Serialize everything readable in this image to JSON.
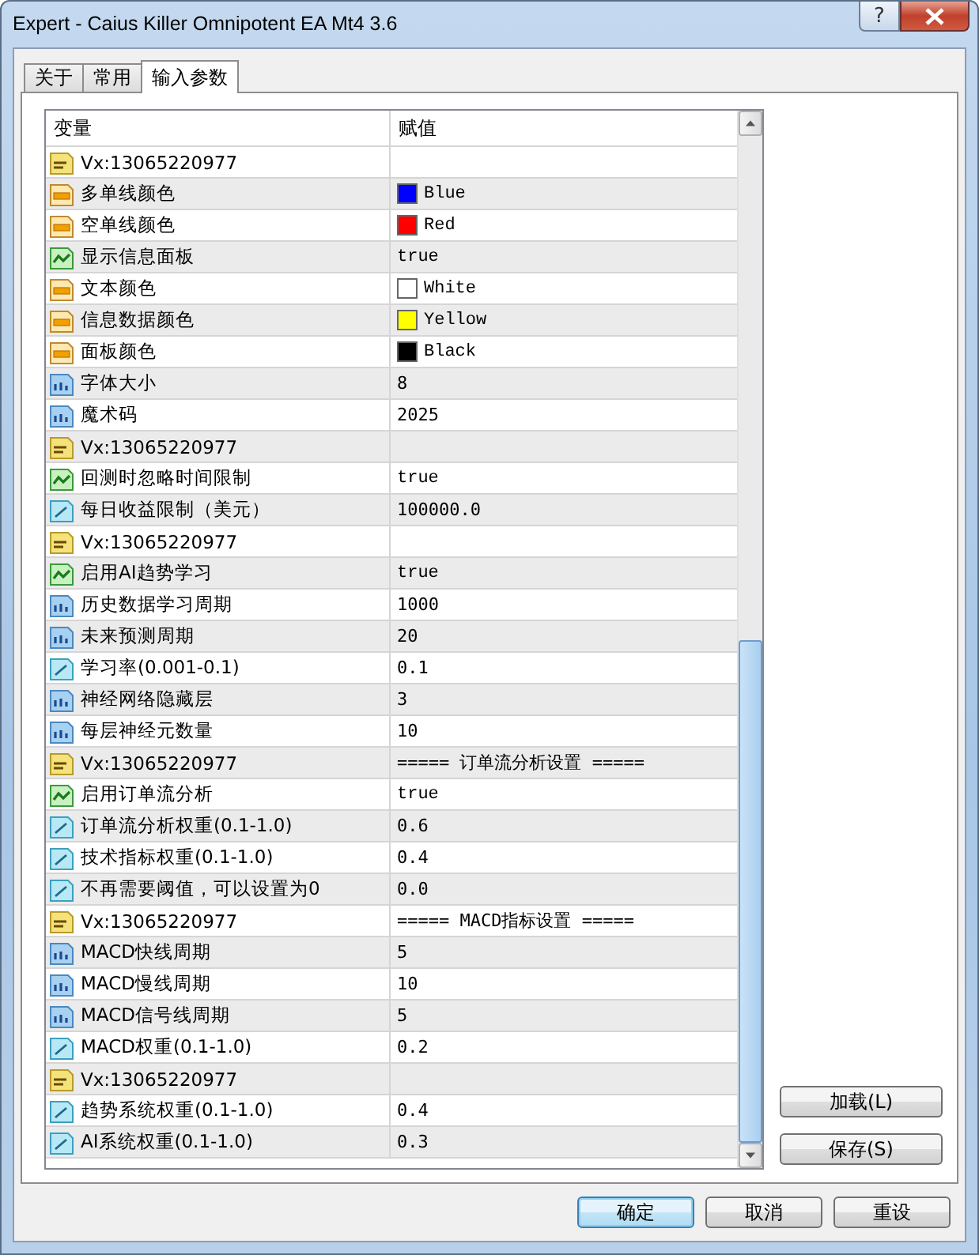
{
  "window": {
    "title": "Expert - Caius Killer Omnipotent EA Mt4 3.6",
    "help": "?"
  },
  "tabs": [
    {
      "label": "关于",
      "selected": false
    },
    {
      "label": "常用",
      "selected": false
    },
    {
      "label": "输入参数",
      "selected": true
    }
  ],
  "table": {
    "columns": [
      "变量",
      "赋值"
    ],
    "rows": [
      {
        "kind": "string",
        "name": "Vx:13065220977",
        "value": ""
      },
      {
        "kind": "color",
        "name": "多单线颜色",
        "value": "Blue",
        "color": "#0000ff"
      },
      {
        "kind": "color",
        "name": "空单线颜色",
        "value": "Red",
        "color": "#ff0000"
      },
      {
        "kind": "bool",
        "name": "显示信息面板",
        "value": "true"
      },
      {
        "kind": "color",
        "name": "文本颜色",
        "value": "White",
        "color": "#ffffff"
      },
      {
        "kind": "color",
        "name": "信息数据颜色",
        "value": "Yellow",
        "color": "#ffff00"
      },
      {
        "kind": "color",
        "name": "面板颜色",
        "value": "Black",
        "color": "#000000"
      },
      {
        "kind": "int",
        "name": "字体大小",
        "value": "8"
      },
      {
        "kind": "int",
        "name": "魔术码",
        "value": "2025"
      },
      {
        "kind": "string",
        "name": "Vx:13065220977",
        "value": ""
      },
      {
        "kind": "bool",
        "name": "回测时忽略时间限制",
        "value": "true"
      },
      {
        "kind": "double",
        "name": "每日收益限制（美元）",
        "value": "100000.0"
      },
      {
        "kind": "string",
        "name": "Vx:13065220977",
        "value": ""
      },
      {
        "kind": "bool",
        "name": "启用AI趋势学习",
        "value": "true"
      },
      {
        "kind": "int",
        "name": "历史数据学习周期",
        "value": "1000"
      },
      {
        "kind": "int",
        "name": "未来预测周期",
        "value": "20"
      },
      {
        "kind": "double",
        "name": "学习率(0.001-0.1)",
        "value": "0.1"
      },
      {
        "kind": "int",
        "name": "神经网络隐藏层",
        "value": "3"
      },
      {
        "kind": "int",
        "name": "每层神经元数量",
        "value": "10"
      },
      {
        "kind": "string",
        "name": "Vx:13065220977",
        "value": "===== 订单流分析设置 ====="
      },
      {
        "kind": "bool",
        "name": "启用订单流分析",
        "value": "true"
      },
      {
        "kind": "double",
        "name": "订单流分析权重(0.1-1.0)",
        "value": "0.6"
      },
      {
        "kind": "double",
        "name": "技术指标权重(0.1-1.0)",
        "value": "0.4"
      },
      {
        "kind": "double",
        "name": "不再需要阈值，可以设置为0",
        "value": "0.0"
      },
      {
        "kind": "string",
        "name": "Vx:13065220977",
        "value": "===== MACD指标设置 ====="
      },
      {
        "kind": "int",
        "name": "MACD快线周期",
        "value": "5"
      },
      {
        "kind": "int",
        "name": "MACD慢线周期",
        "value": "10"
      },
      {
        "kind": "int",
        "name": "MACD信号线周期",
        "value": "5"
      },
      {
        "kind": "double",
        "name": "MACD权重(0.1-1.0)",
        "value": "0.2"
      },
      {
        "kind": "string",
        "name": "Vx:13065220977",
        "value": ""
      },
      {
        "kind": "double",
        "name": "趋势系统权重(0.1-1.0)",
        "value": "0.4"
      },
      {
        "kind": "double",
        "name": "AI系统权重(0.1-1.0)",
        "value": "0.3"
      }
    ]
  },
  "side_buttons": [
    "加载(L)",
    "保存(S)"
  ],
  "buttons": [
    {
      "label": "确定",
      "default": true
    },
    {
      "label": "取消",
      "default": false
    },
    {
      "label": "重设",
      "default": false
    }
  ]
}
